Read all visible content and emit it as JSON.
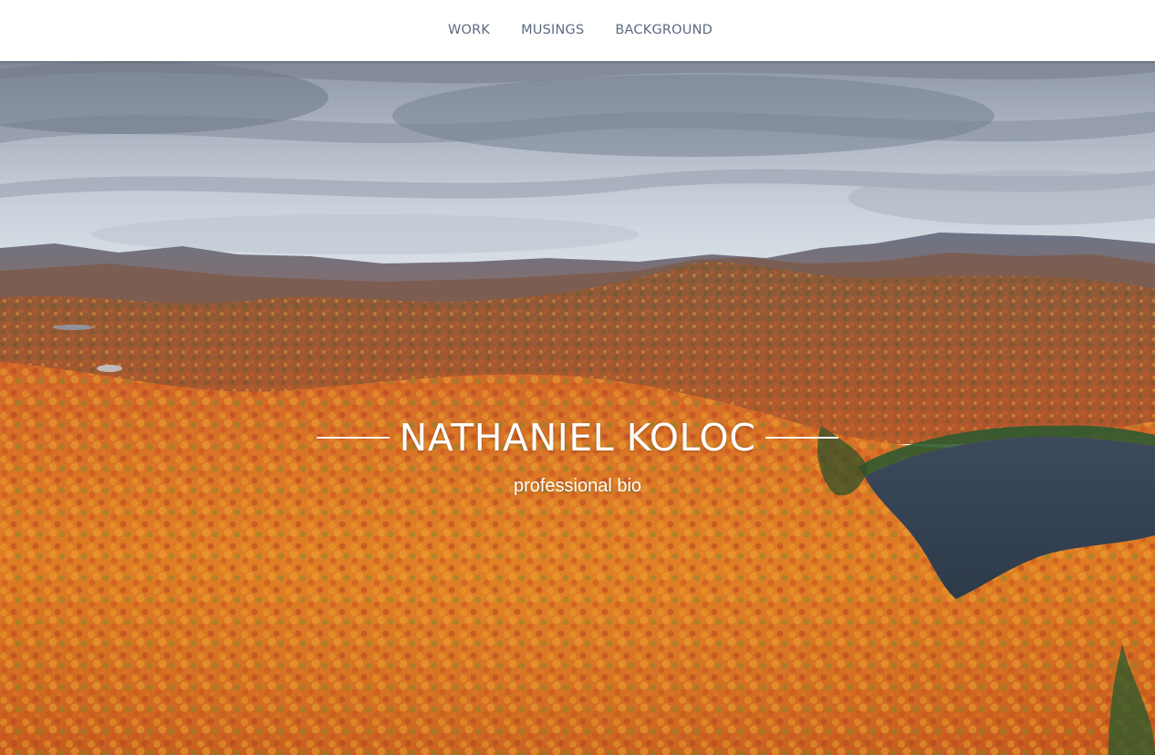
{
  "nav": {
    "items": [
      {
        "label": "WORK"
      },
      {
        "label": "MUSINGS"
      },
      {
        "label": "BACKGROUND"
      }
    ]
  },
  "hero": {
    "title": "NATHANIEL KOLOC",
    "subtitle": "professional bio",
    "image_description": "Aerial view of autumn forest hills with a lake and cloudy sky"
  },
  "colors": {
    "nav_text": "#5c6b80",
    "nav_bg": "#ffffff",
    "hero_text": "#ffffff"
  }
}
